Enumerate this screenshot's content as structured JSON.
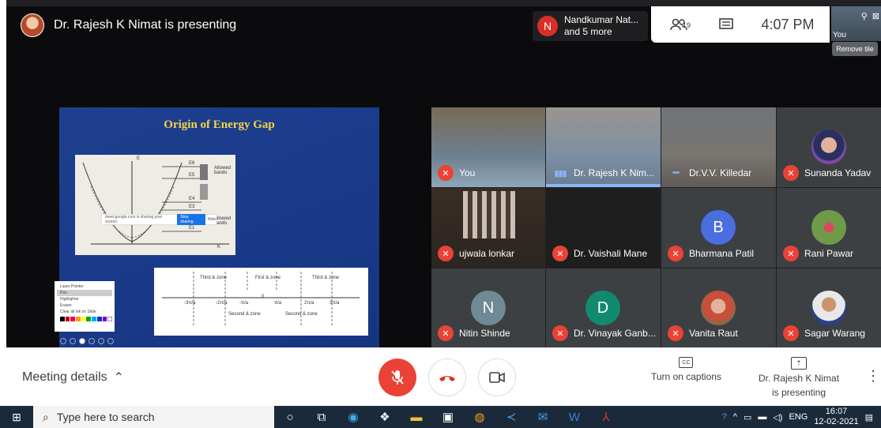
{
  "meeting": {
    "presenting_text": "Dr. Rajesh K Nimat is presenting",
    "participant_pill": {
      "avatar_letter": "N",
      "line1": "Nandkumar Nat...",
      "line2": "and 5 more"
    },
    "people_count": "19",
    "time": "4:07 PM",
    "self_tile_label": "You",
    "tooltip": "Remove tile"
  },
  "slide": {
    "title": "Origin of Energy Gap",
    "allowed_bands": [
      "Allowed bands",
      "Allowed bands"
    ],
    "energy_levels": [
      "E6",
      "E5",
      "E4",
      "E3",
      "E2",
      "E1"
    ],
    "diagram_axis_k": "K",
    "diagram_axis_e": "E",
    "zones": [
      "Third & zone",
      "First & zone",
      "Third & zone",
      "Second & zone",
      "Second & zone"
    ],
    "axis_ticks": [
      "-3π/a",
      "-2π/a",
      "-π/a",
      "0",
      "π/a",
      "2π/a",
      "3π/a"
    ],
    "share_text": "meet.google.com is sharing your screen.",
    "stop_sharing": "Stop sharing",
    "hide": "Hide",
    "pen_menu": [
      "Laser Pointer",
      "Pen",
      "Highlighter",
      "Eraser",
      "Clear all ink on Slide"
    ]
  },
  "tiles": [
    {
      "name": "You",
      "status": "muted"
    },
    {
      "name": "Dr. Rajesh K Nim...",
      "status": "speaking"
    },
    {
      "name": "Dr.V.V. Killedar",
      "status": "active"
    },
    {
      "name": "Sunanda Yadav",
      "status": "muted"
    },
    {
      "name": "ujwala lonkar",
      "status": "muted"
    },
    {
      "name": "Dr. Vaishali Mane",
      "status": "muted"
    },
    {
      "name": "Bharmana Patil",
      "status": "muted",
      "letter": "B"
    },
    {
      "name": "Rani Pawar",
      "status": "muted"
    },
    {
      "name": "Nitin Shinde",
      "status": "muted",
      "letter": "N"
    },
    {
      "name": "Dr. Vinayak Ganb...",
      "status": "muted",
      "letter": "D"
    },
    {
      "name": "Vanita Raut",
      "status": "muted"
    },
    {
      "name": "Sagar Warang",
      "status": "muted"
    }
  ],
  "controls": {
    "meeting_details": "Meeting details",
    "captions": "Turn on captions",
    "cc": "CC",
    "presenting_line1": "Dr. Rajesh K Nimat",
    "presenting_line2": "is presenting"
  },
  "taskbar": {
    "search_placeholder": "Type here to search",
    "lang": "ENG",
    "clock_time": "16:07",
    "clock_date": "12-02-2021"
  },
  "colors": {
    "mute_red": "#ea4335",
    "speaking_blue": "#8ab4f8",
    "slide_blue": "#1d3f8e",
    "title_yellow": "#f5d447"
  }
}
